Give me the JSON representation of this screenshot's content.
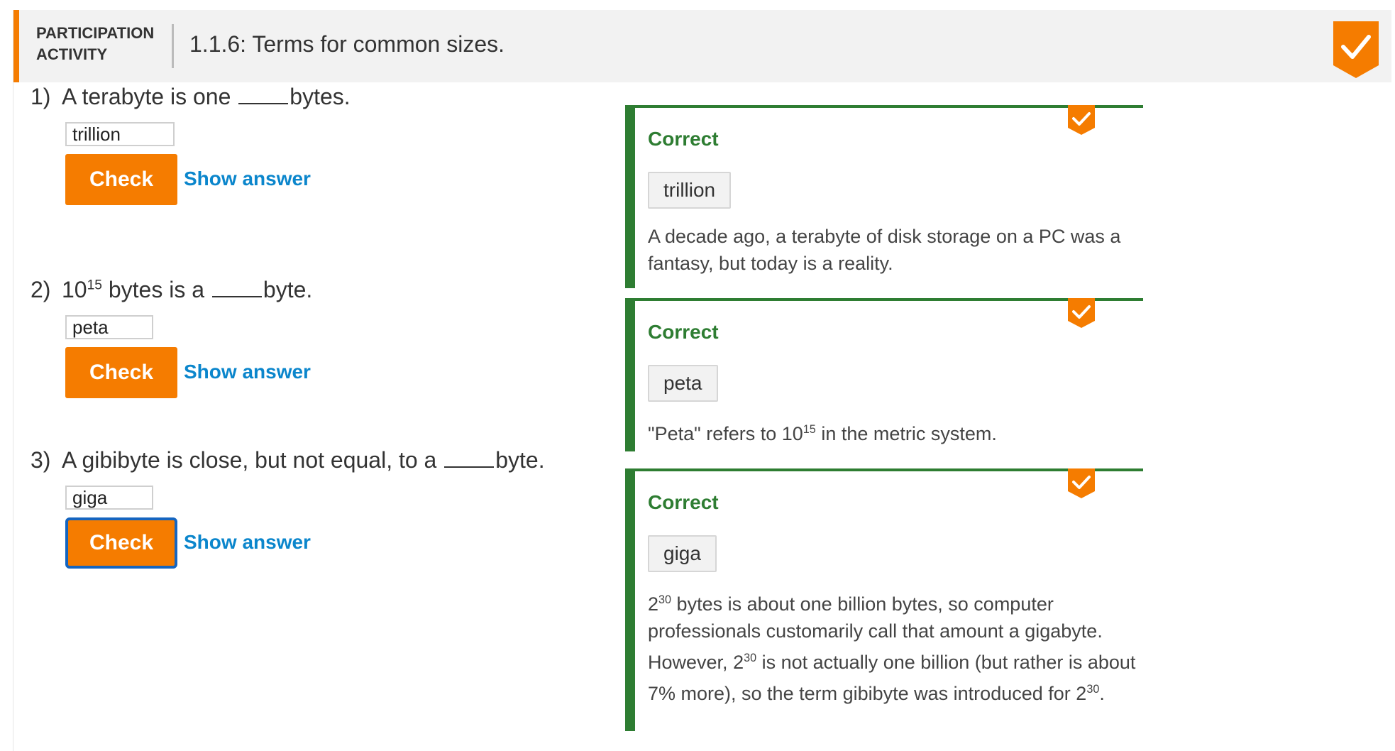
{
  "header": {
    "label_line1": "PARTICIPATION",
    "label_line2": "ACTIVITY",
    "title": "1.1.6: Terms for common sizes."
  },
  "colors": {
    "accent": "#f57c00",
    "correct": "#2e7d32",
    "link": "#0b86cc"
  },
  "questions": [
    {
      "number": "1)",
      "text_before": "A terabyte is one ",
      "text_after": "bytes.",
      "input_value": "trillion",
      "check_label": "Check",
      "show_answer_label": "Show answer",
      "feedback_status": "Correct",
      "feedback_answer": "trillion",
      "explanation": "A decade ago, a terabyte of disk storage on a PC was a fantasy, but today is a reality."
    },
    {
      "number": "2)",
      "text_base": "10",
      "text_exp": "15",
      "text_before": " bytes is a ",
      "text_after": "byte.",
      "input_value": "peta",
      "check_label": "Check",
      "show_answer_label": "Show answer",
      "feedback_status": "Correct",
      "feedback_answer": "peta",
      "explanation_pre": "\"Peta\" refers to 10",
      "explanation_exp": "15",
      "explanation_post": " in the metric system."
    },
    {
      "number": "3)",
      "text_before": "A gibibyte is close, but not equal, to a ",
      "text_after": "byte.",
      "input_value": "giga",
      "check_label": "Check",
      "show_answer_label": "Show answer",
      "feedback_status": "Correct",
      "feedback_answer": "giga",
      "expl_a_base": "2",
      "expl_a_exp": "30",
      "expl_a_text": " bytes is about one billion bytes, so computer professionals customarily call that amount a gigabyte. However, ",
      "expl_b_base": "2",
      "expl_b_exp": "30",
      "expl_b_text": " is not actually one billion (but rather is about 7% more), so the term gibibyte was introduced for ",
      "expl_c_base": "2",
      "expl_c_exp": "30",
      "expl_c_text": "."
    }
  ]
}
